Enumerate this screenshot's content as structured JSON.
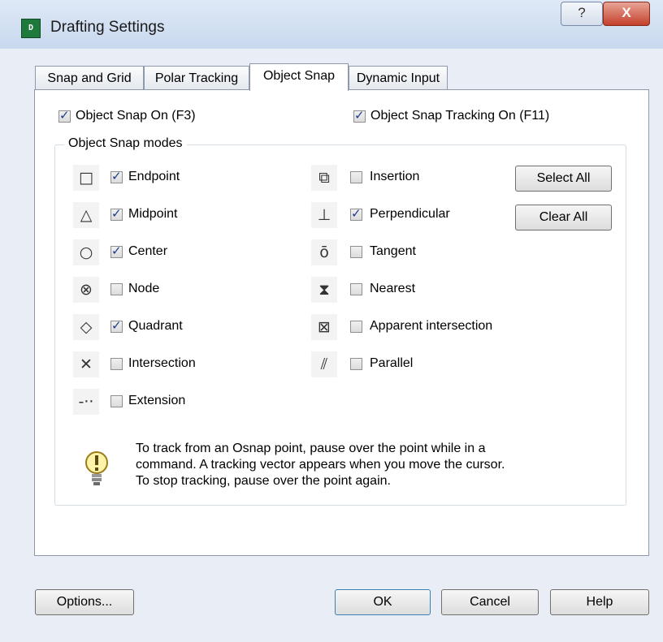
{
  "window": {
    "title": "Drafting Settings",
    "app_icon_text": "D",
    "help_glyph": "?",
    "close_glyph": "X"
  },
  "tabs": [
    "Snap and Grid",
    "Polar Tracking",
    "Object Snap",
    "Dynamic Input"
  ],
  "active_tab": "Object Snap",
  "options": {
    "osnap_on": {
      "label": "Object Snap On (F3)",
      "checked": true
    },
    "tracking_on": {
      "label": "Object Snap Tracking On (F11)",
      "checked": true
    }
  },
  "group_title": "Object Snap modes",
  "modes_left": [
    {
      "label": "Endpoint",
      "checked": true,
      "icon": "endpoint-icon",
      "glyph": "□"
    },
    {
      "label": "Midpoint",
      "checked": true,
      "icon": "midpoint-icon",
      "glyph": "△"
    },
    {
      "label": "Center",
      "checked": true,
      "icon": "center-icon",
      "glyph": "○"
    },
    {
      "label": "Node",
      "checked": false,
      "icon": "node-icon",
      "glyph": "⊗"
    },
    {
      "label": "Quadrant",
      "checked": true,
      "icon": "quadrant-icon",
      "glyph": "◇"
    },
    {
      "label": "Intersection",
      "checked": false,
      "icon": "intersection-icon",
      "glyph": "✕"
    },
    {
      "label": "Extension",
      "checked": false,
      "icon": "extension-icon",
      "glyph": "-··"
    }
  ],
  "modes_right": [
    {
      "label": "Insertion",
      "checked": false,
      "icon": "insertion-icon",
      "glyph": "⧉"
    },
    {
      "label": "Perpendicular",
      "checked": true,
      "icon": "perpendicular-icon",
      "glyph": "⊥"
    },
    {
      "label": "Tangent",
      "checked": false,
      "icon": "tangent-icon",
      "glyph": "ō"
    },
    {
      "label": "Nearest",
      "checked": false,
      "icon": "nearest-icon",
      "glyph": "⧗"
    },
    {
      "label": "Apparent intersection",
      "checked": false,
      "icon": "apparent-intersection-icon",
      "glyph": "⊠"
    },
    {
      "label": "Parallel",
      "checked": false,
      "icon": "parallel-icon",
      "glyph": "⫽"
    }
  ],
  "buttons": {
    "select_all": "Select All",
    "clear_all": "Clear All"
  },
  "tip": {
    "line1": "To track from an Osnap point, pause over the point while in a",
    "line2": "command.  A tracking vector appears when you move the cursor.",
    "line3": "To stop tracking, pause over the point again."
  },
  "footer": {
    "options": "Options...",
    "ok": "OK",
    "cancel": "Cancel",
    "help": "Help"
  }
}
